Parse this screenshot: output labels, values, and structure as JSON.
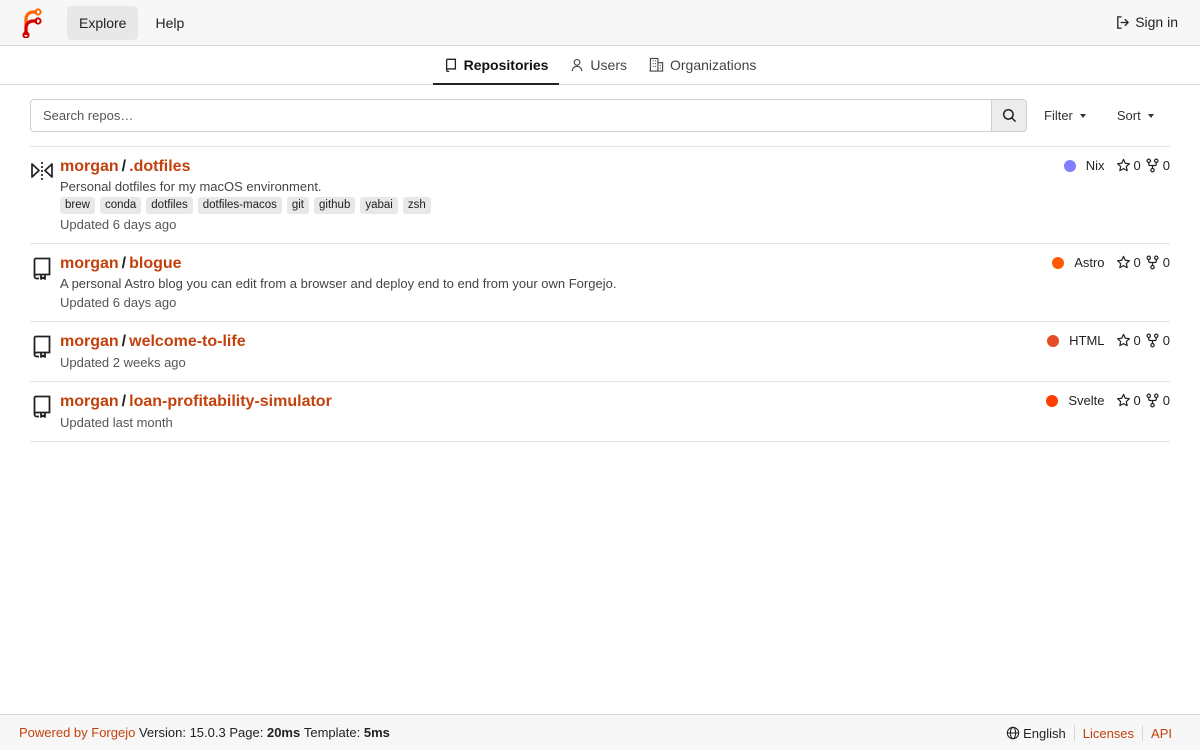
{
  "nav": {
    "explore": "Explore",
    "help": "Help",
    "signin": "Sign in"
  },
  "tabs": [
    {
      "label": "Repositories",
      "active": true
    },
    {
      "label": "Users",
      "active": false
    },
    {
      "label": "Organizations",
      "active": false
    }
  ],
  "search": {
    "placeholder": "Search repos…",
    "value": "",
    "filter_label": "Filter",
    "sort_label": "Sort"
  },
  "repos": [
    {
      "owner": "morgan",
      "name": ".dotfiles",
      "icon": "mirror-icon",
      "description": "Personal dotfiles for my macOS environment.",
      "topics": [
        "brew",
        "conda",
        "dotfiles",
        "dotfiles-macos",
        "git",
        "github",
        "yabai",
        "zsh"
      ],
      "updated": "Updated 6 days ago",
      "language": "Nix",
      "language_color": "#7e7eff",
      "stars": "0",
      "forks": "0"
    },
    {
      "owner": "morgan",
      "name": "blogue",
      "icon": "repo-icon",
      "description": "A personal Astro blog you can edit from a browser and deploy end to end from your own Forgejo.",
      "topics": [],
      "updated": "Updated 6 days ago",
      "language": "Astro",
      "language_color": "#ff5a03",
      "stars": "0",
      "forks": "0"
    },
    {
      "owner": "morgan",
      "name": "welcome-to-life",
      "icon": "repo-icon",
      "description": "",
      "topics": [],
      "updated": "Updated 2 weeks ago",
      "language": "HTML",
      "language_color": "#e34c26",
      "stars": "0",
      "forks": "0"
    },
    {
      "owner": "morgan",
      "name": "loan-profitability-simulator",
      "icon": "repo-icon",
      "description": "",
      "topics": [],
      "updated": "Updated last month",
      "language": "Svelte",
      "language_color": "#ff3e00",
      "stars": "0",
      "forks": "0"
    }
  ],
  "footer": {
    "powered_by": "Powered by Forgejo",
    "version_label": "Version:",
    "version": "15.0.3",
    "page_label": "Page:",
    "page_time": "20ms",
    "template_label": "Template:",
    "template_time": "5ms",
    "language": "English",
    "licenses": "Licenses",
    "api": "API"
  },
  "colors": {
    "accent": "#c2410c"
  }
}
